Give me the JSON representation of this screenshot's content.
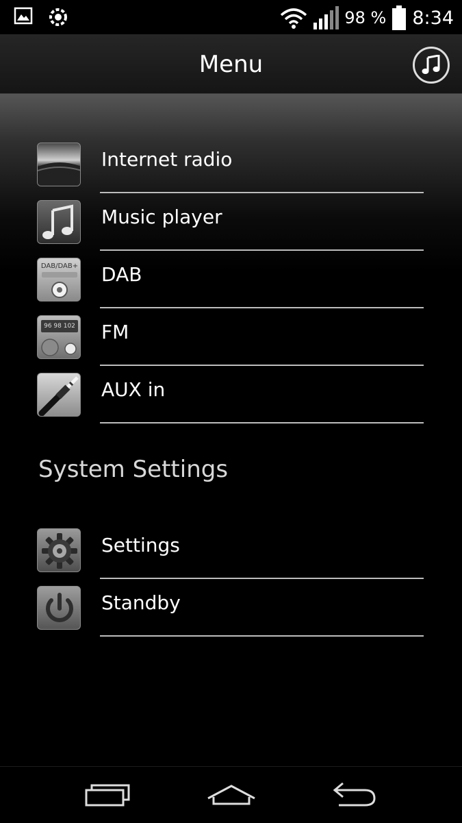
{
  "status_bar": {
    "battery_percent": "98 %",
    "battery_level": 0.98,
    "time": "8:34",
    "left_icons": [
      "gallery-icon",
      "sync-icon"
    ],
    "right_icons": [
      "wifi-icon",
      "signal-icon",
      "battery-icon"
    ]
  },
  "action_bar": {
    "title": "Menu",
    "right_icon": "music-note-icon"
  },
  "menu": {
    "items": [
      {
        "label": "Internet radio",
        "icon": "internet-radio-icon"
      },
      {
        "label": "Music player",
        "icon": "music-player-icon"
      },
      {
        "label": "DAB",
        "icon": "dab-icon",
        "icon_text": "DAB/DAB+"
      },
      {
        "label": "FM",
        "icon": "fm-icon",
        "icon_text": "96 98 102"
      },
      {
        "label": "AUX in",
        "icon": "aux-in-icon"
      }
    ]
  },
  "system_settings": {
    "title": "System Settings",
    "items": [
      {
        "label": "Settings",
        "icon": "gear-icon"
      },
      {
        "label": "Standby",
        "icon": "power-icon"
      }
    ]
  },
  "nav_bar": {
    "icons": [
      "recent-apps-icon",
      "home-icon",
      "back-icon"
    ]
  },
  "colors": {
    "background": "#000000",
    "text": "#ffffff",
    "divider": "#bdbdbd",
    "section_title": "#d8d8d8"
  }
}
